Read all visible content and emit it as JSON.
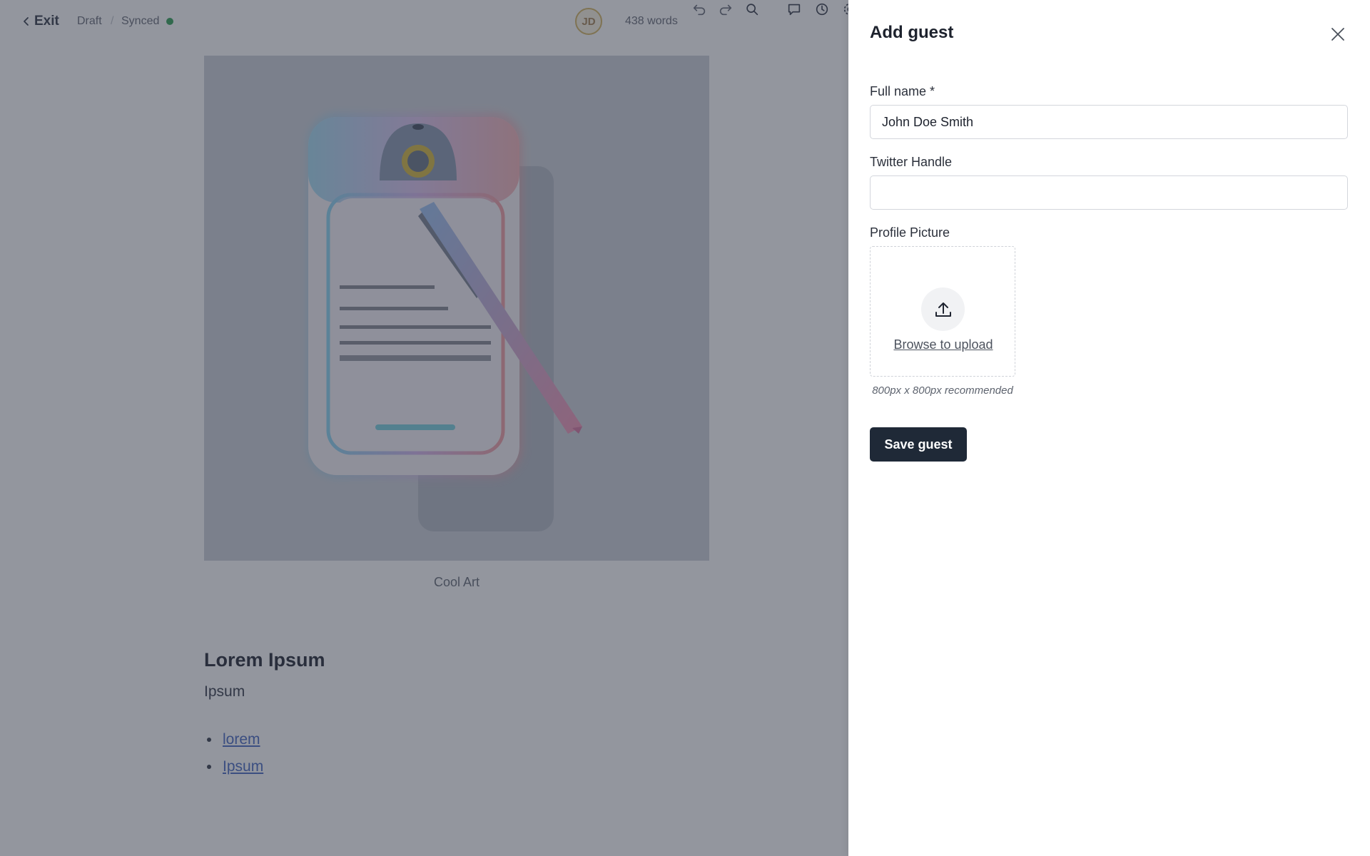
{
  "topbar": {
    "exit_label": "Exit",
    "status": "Draft",
    "separator": "/",
    "sync_label": "Synced",
    "avatar_initials": "JD",
    "word_count": "438 words"
  },
  "document": {
    "image_caption": "Cool Art",
    "heading": "Lorem Ipsum",
    "paragraph": "Ipsum",
    "list_items": [
      "lorem",
      "Ipsum"
    ]
  },
  "drawer": {
    "title": "Add guest",
    "full_name_label": "Full name *",
    "full_name_value": "John Doe Smith",
    "twitter_label": "Twitter Handle",
    "twitter_value": "",
    "profile_label": "Profile Picture",
    "upload_text": "Browse to upload",
    "upload_hint": "800px x 800px recommended",
    "save_label": "Save guest"
  },
  "colors": {
    "overlay": "#282d3e",
    "save_button": "#1f2937",
    "synced_dot": "#3ba55d",
    "link": "#4e6fc4"
  }
}
